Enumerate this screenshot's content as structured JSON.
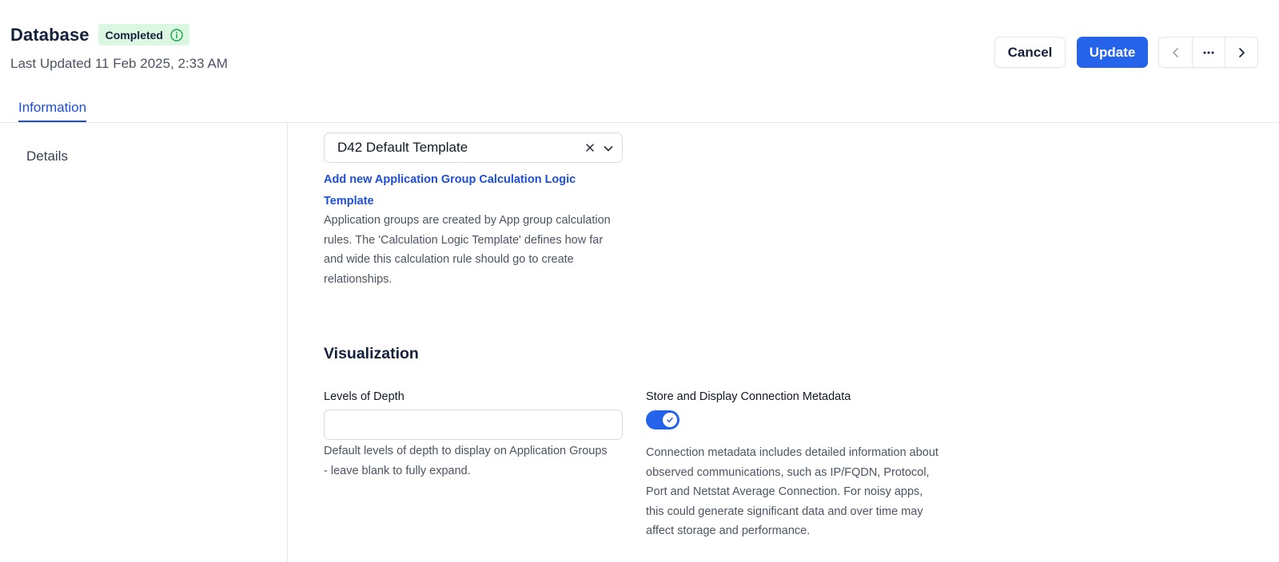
{
  "header": {
    "title": "Database",
    "status": "Completed",
    "last_updated": "Last Updated 11 Feb 2025, 2:33 AM",
    "actions": {
      "cancel_label": "Cancel",
      "update_label": "Update"
    }
  },
  "tabs": [
    {
      "label": "Information",
      "active": true
    }
  ],
  "sidebar": {
    "items": [
      {
        "label": "Details"
      }
    ]
  },
  "form": {
    "calculation_logic_template": {
      "selected_value": "D42 Default Template",
      "add_link": "Add new Application Group Calculation Logic Template",
      "help": "Application groups are created by App group calculation rules. The 'Calculation Logic Template' defines how far and wide this calculation rule should go to create relationships."
    },
    "visualization": {
      "section_title": "Visualization",
      "levels_of_depth": {
        "label": "Levels of Depth",
        "value": "",
        "help": "Default levels of depth to display on Application Groups - leave blank to fully expand."
      },
      "connection_metadata": {
        "label": "Store and Display Connection Metadata",
        "enabled": true,
        "help": "Connection metadata includes detailed information about observed communications, such as IP/FQDN, Protocol, Port and Netstat Average Connection. For noisy apps, this could generate significant data and over time may affect storage and performance."
      }
    }
  },
  "colors": {
    "accent": "#2563eb",
    "link": "#1d4ed8",
    "status_badge_bg": "#dcf7e1",
    "status_icon": "#16a34a",
    "title": "#14213d"
  },
  "icons": {
    "status_info": "info-circle-icon",
    "nav_prev": "chevron-left-icon",
    "nav_more": "more-horizontal-icon",
    "nav_next": "chevron-right-icon",
    "select_clear": "close-icon",
    "select_open": "chevron-down-icon",
    "toggle_check": "check-icon"
  }
}
